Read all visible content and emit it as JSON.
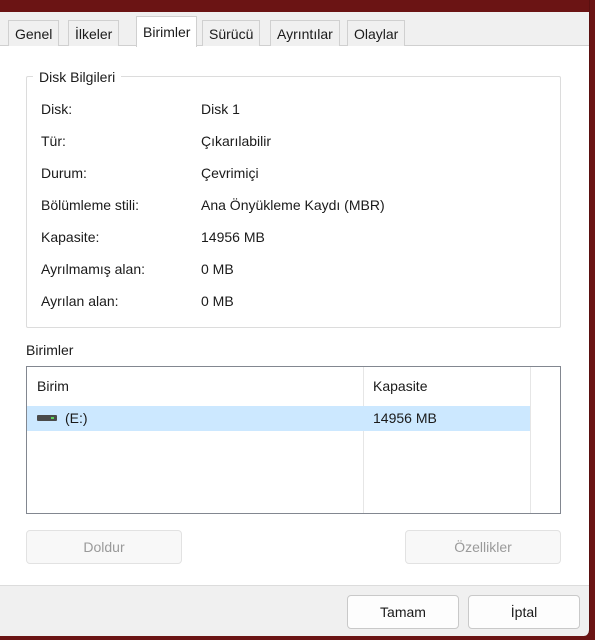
{
  "tabs": [
    {
      "label": "Genel"
    },
    {
      "label": "İlkeler"
    },
    {
      "label": "Birimler"
    },
    {
      "label": "Sürücü"
    },
    {
      "label": "Ayrıntılar"
    },
    {
      "label": "Olaylar"
    }
  ],
  "active_tab": "Birimler",
  "disk_info": {
    "title": "Disk Bilgileri",
    "rows": [
      {
        "key": "Disk:",
        "value": "Disk 1"
      },
      {
        "key": "Tür:",
        "value": "Çıkarılabilir"
      },
      {
        "key": "Durum:",
        "value": "Çevrimiçi"
      },
      {
        "key": "Bölümleme stili:",
        "value": "Ana Önyükleme Kaydı (MBR)"
      },
      {
        "key": "Kapasite:",
        "value": "14956 MB"
      },
      {
        "key": "Ayrılmamış alan:",
        "value": "0 MB"
      },
      {
        "key": "Ayrılan alan:",
        "value": "0 MB"
      }
    ]
  },
  "volumes": {
    "section_label": "Birimler",
    "columns": [
      "Birim",
      "Kapasite"
    ],
    "rows": [
      {
        "name": "(E:)",
        "capacity": "14956 MB",
        "icon": "drive-icon",
        "selected": true
      }
    ]
  },
  "buttons": {
    "populate": "Doldur",
    "properties": "Özellikler",
    "ok": "Tamam",
    "cancel": "İptal"
  },
  "colors": {
    "window_frame": "#6b1414",
    "selection": "#cce8ff"
  }
}
